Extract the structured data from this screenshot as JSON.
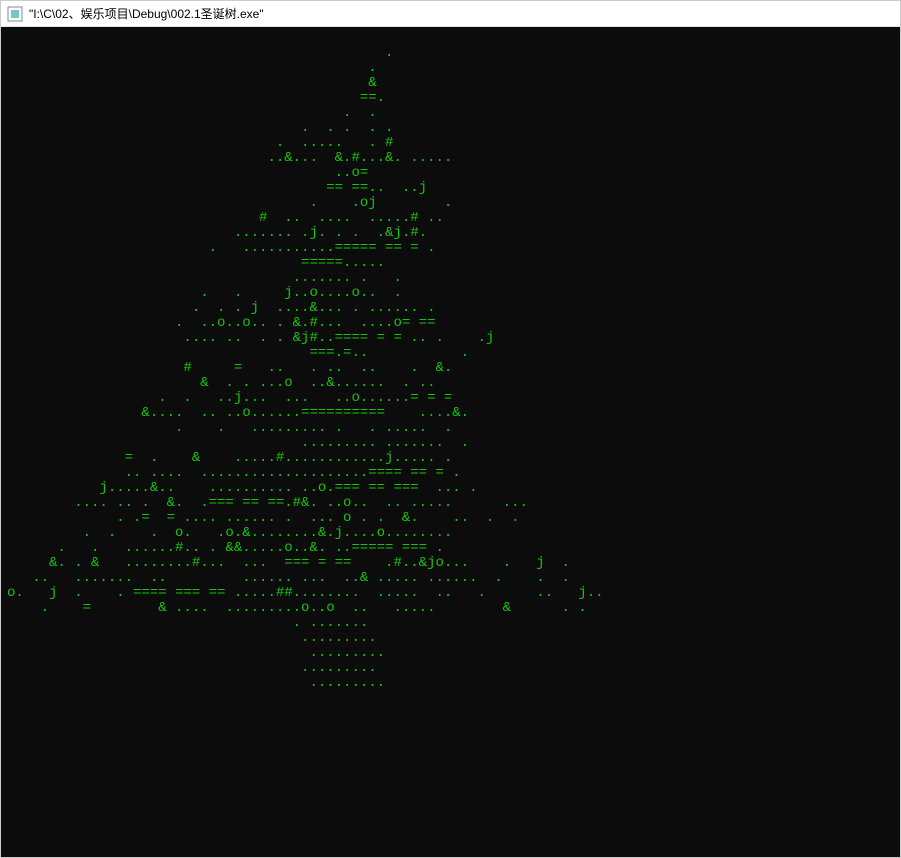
{
  "window": {
    "title": "\"I:\\C\\02、娱乐项目\\Debug\\002.1圣诞树.exe\""
  },
  "colors": {
    "console_bg": "#0c0c0c",
    "console_fg": "#16c60c"
  },
  "console": {
    "lines": [
      "",
      "                                             .",
      "                                           .",
      "                                           &",
      "                                          ==.",
      "                                        .  .",
      "                                   .  . .  . .",
      "                                .  .....   . #",
      "                               ..&...  &.#...&. .....",
      "                                       ..o=",
      "                                      == ==..  ..j",
      "                                    .    .oj        .",
      "                              #  ..  ....  .....# ..",
      "                           ....... .j. . .  .&j.#.",
      "                        .   ...........===== == = .",
      "                                   =====.....",
      "                                  ....... .   .",
      "                       .   .     j..o....o..  .",
      "                      .  . . j  ....&... . ...... .",
      "                    .  ..o..o.. . &.#...  ....o= ==",
      "                     .... ..  . . &j#..==== = = .. .    .j",
      "                                    ===.=..           .",
      "                     #     =   ..   . ..  ..    .  &.",
      "                       &  . . ...o  ..&......  . ..",
      "                  .  .   ..j...  ...   ..o......= = =",
      "                &....  .. ..o......==========    ....&.",
      "                    .    .   ......... .   . .....  .",
      "                                   ......... .......  .",
      "              =  .    &    .....#............j..... .",
      "              .. ....  ....................==== == = .",
      "           j.....&..    .......... ..o.=== == ===  ... .",
      "        .... .. .  &.  .=== == ==.#&. ..o..  .. .....      ...",
      "             . .=  = .... ...... .  ... o . .  &.    ..  .  .",
      "         .  .    .  o.   .o.&........&.j....o........",
      "      .   .   ......#.. . &&.....o..&. ..===== === .",
      "     &. . &   ........#...  ...  === = ==    .#..&jo...    .   j  .",
      "   ..   .......  ..         ...... ...  ..& ..... ......  .    .  .",
      "o.   j  .    . ==== === == .....##........  .....  ..   .      ..   j..",
      "    .    =        & ....  .........o..o  ..   .....        &      . .",
      "                                  . .......",
      "                                   .........",
      "                                    .........",
      "                                   .........",
      "                                    ........."
    ]
  }
}
